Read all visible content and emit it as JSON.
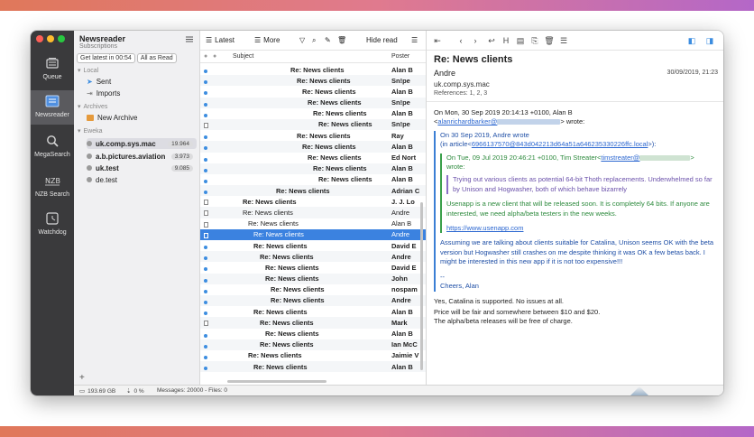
{
  "sidebar": {
    "title": "Newsreader",
    "subtitle": "Subscriptions",
    "filter_latest": "Get latest in 00:54",
    "filter_read": "All as Read",
    "local_label": "Local",
    "local_items": [
      "Sent",
      "Imports"
    ],
    "archives_label": "Archives",
    "archive_items": [
      "New Archive"
    ],
    "server_label": "Eweka",
    "groups": [
      {
        "name": "uk.comp.sys.mac",
        "count": "19.964"
      },
      {
        "name": "a.b.pictures.aviation",
        "count": "3.973"
      },
      {
        "name": "uk.test",
        "count": "9.085"
      },
      {
        "name": "de.test",
        "count": ""
      }
    ]
  },
  "tools": [
    {
      "label": "Queue",
      "icon": "queue-icon"
    },
    {
      "label": "Newsreader",
      "icon": "newsreader-icon"
    },
    {
      "label": "MegaSearch",
      "icon": "magnifier-icon"
    },
    {
      "label": "NZB Search",
      "icon": "nzb-icon"
    },
    {
      "label": "Watchdog",
      "icon": "watchdog-icon"
    }
  ],
  "list_toolbar": {
    "latest": "Latest",
    "more": "More",
    "hide_read": "Hide read"
  },
  "list_header": {
    "subject": "Subject",
    "poster": "Poster"
  },
  "rows": [
    {
      "subject": "Re: News clients",
      "poster": "Alan B",
      "indent": 100,
      "bold": true,
      "icon": "dot"
    },
    {
      "subject": "Re: News clients",
      "poster": "Sn!pe",
      "indent": 107,
      "bold": true,
      "icon": "dot"
    },
    {
      "subject": "Re: News clients",
      "poster": "Alan B",
      "indent": 113,
      "bold": true,
      "icon": "dot"
    },
    {
      "subject": "Re: News clients",
      "poster": "Sn!pe",
      "indent": 119,
      "bold": true,
      "icon": "dot"
    },
    {
      "subject": "Re: News clients",
      "poster": "Alan B",
      "indent": 125,
      "bold": true,
      "icon": "dot"
    },
    {
      "subject": "Re: News clients",
      "poster": "Sn!pe",
      "indent": 131,
      "bold": true,
      "icon": "doc"
    },
    {
      "subject": "Re: News clients",
      "poster": "Ray",
      "indent": 107,
      "bold": true,
      "icon": "dot"
    },
    {
      "subject": "Re: News clients",
      "poster": "Alan B",
      "indent": 113,
      "bold": true,
      "icon": "dot"
    },
    {
      "subject": "Re: News clients",
      "poster": "Ed Nort",
      "indent": 119,
      "bold": true,
      "icon": "dot"
    },
    {
      "subject": "Re: News clients",
      "poster": "Alan B",
      "indent": 125,
      "bold": true,
      "icon": "dot"
    },
    {
      "subject": "Re: News clients",
      "poster": "Alan B",
      "indent": 131,
      "bold": true,
      "icon": "dot"
    },
    {
      "subject": "Re: News clients",
      "poster": "Adrian C",
      "indent": 84,
      "bold": true,
      "icon": "dot"
    },
    {
      "subject": "Re: News clients",
      "poster": "J. J. Lo",
      "indent": 47,
      "bold": true,
      "icon": "doc"
    },
    {
      "subject": "Re: News clients",
      "poster": "Andre",
      "indent": 47,
      "bold": false,
      "icon": "doc"
    },
    {
      "subject": "Re: News clients",
      "poster": "Alan B",
      "indent": 53,
      "bold": false,
      "icon": "doc"
    },
    {
      "subject": "Re: News clients",
      "poster": "Andre",
      "indent": 59,
      "bold": false,
      "icon": "doc",
      "selected": true
    },
    {
      "subject": "Re: News clients",
      "poster": "David E",
      "indent": 59,
      "bold": true,
      "icon": "dot"
    },
    {
      "subject": "Re: News clients",
      "poster": "Andre",
      "indent": 66,
      "bold": true,
      "icon": "dot"
    },
    {
      "subject": "Re: News clients",
      "poster": "David E",
      "indent": 72,
      "bold": true,
      "icon": "dot"
    },
    {
      "subject": "Re: News clients",
      "poster": "John",
      "indent": 72,
      "bold": true,
      "icon": "dot"
    },
    {
      "subject": "Re: News clients",
      "poster": "nospam",
      "indent": 78,
      "bold": true,
      "icon": "dot"
    },
    {
      "subject": "Re: News clients",
      "poster": "Andre",
      "indent": 78,
      "bold": true,
      "icon": "dot"
    },
    {
      "subject": "Re: News clients",
      "poster": "Alan B",
      "indent": 59,
      "bold": true,
      "icon": "dot"
    },
    {
      "subject": "Re: News clients",
      "poster": "Mark",
      "indent": 66,
      "bold": true,
      "icon": "doc"
    },
    {
      "subject": "Re: News clients",
      "poster": "Alan B",
      "indent": 72,
      "bold": true,
      "icon": "dot"
    },
    {
      "subject": "Re: News clients",
      "poster": "Ian McC",
      "indent": 66,
      "bold": true,
      "icon": "dot"
    },
    {
      "subject": "Re: News clients",
      "poster": "Jaimie V",
      "indent": 53,
      "bold": true,
      "icon": "dot"
    },
    {
      "subject": "Re: News clients",
      "poster": "Alan B",
      "indent": 59,
      "bold": true,
      "icon": "dot"
    }
  ],
  "reader": {
    "subject": "Re: News clients",
    "from": "Andre",
    "date": "30/09/2019, 21:23",
    "group": "uk.comp.sys.mac",
    "references": "References: 1, 2, 3",
    "attrib1_pre": "On Mon, 30 Sep 2019 20:14:13 +0100, Alan B",
    "attrib1_lt": "<",
    "attrib1_link": "alanrichardbarker@",
    "attrib1_post": "> wrote:",
    "attrib2": "On 30 Sep 2019, Andre wrote",
    "attrib2b_pre": "(in article<",
    "attrib2b_link": "6966137570@843d042213d64a51a646235330226ffc.local",
    "attrib2b_post": ">):",
    "attrib3_pre": "On Tue, 09 Jul 2019 20:46:21 +0100, Tim Streater<",
    "attrib3_link": "timstreater@",
    "attrib3_post": ">",
    "attrib3_wrote": "wrote:",
    "q3_text": "Trying out various clients as potential 64-bit Thoth replacements. Underwhelmed so far by Unison and Hogwasher, both of which behave bizarrely",
    "q2_text": "Usenapp is a new client that will be released soon. It is completely 64 bits. If anyone are interested, we need alpha/beta testers in the new weeks.",
    "q2_link": "https://www.usenapp.com",
    "q1_text": "Assuming we are talking about clients suitable for Catalina, Unison seems OK with the beta version but Hogwasher still crashes on me despite thinking it was OK a few betas back. I might be interested in this new app if it is not too expensive!!!",
    "sig_dash": "--",
    "sig": "Cheers, Alan",
    "reply1": "Yes, Catalina is supported. No issues at all.",
    "reply2": "Price will be fair and somewhere between $10 and $20.",
    "reply3": "The alpha/beta releases will be free of charge."
  },
  "status": {
    "disk": "193.69 GB",
    "percent": "0 %",
    "messages": "Messages: 20000 - Files: 0"
  },
  "colors": {
    "accent": "#3b82e0",
    "dark_toolbar": "#3a3a3c",
    "quote_blue": "#1f4fa6",
    "quote_green": "#2d8a3d"
  }
}
